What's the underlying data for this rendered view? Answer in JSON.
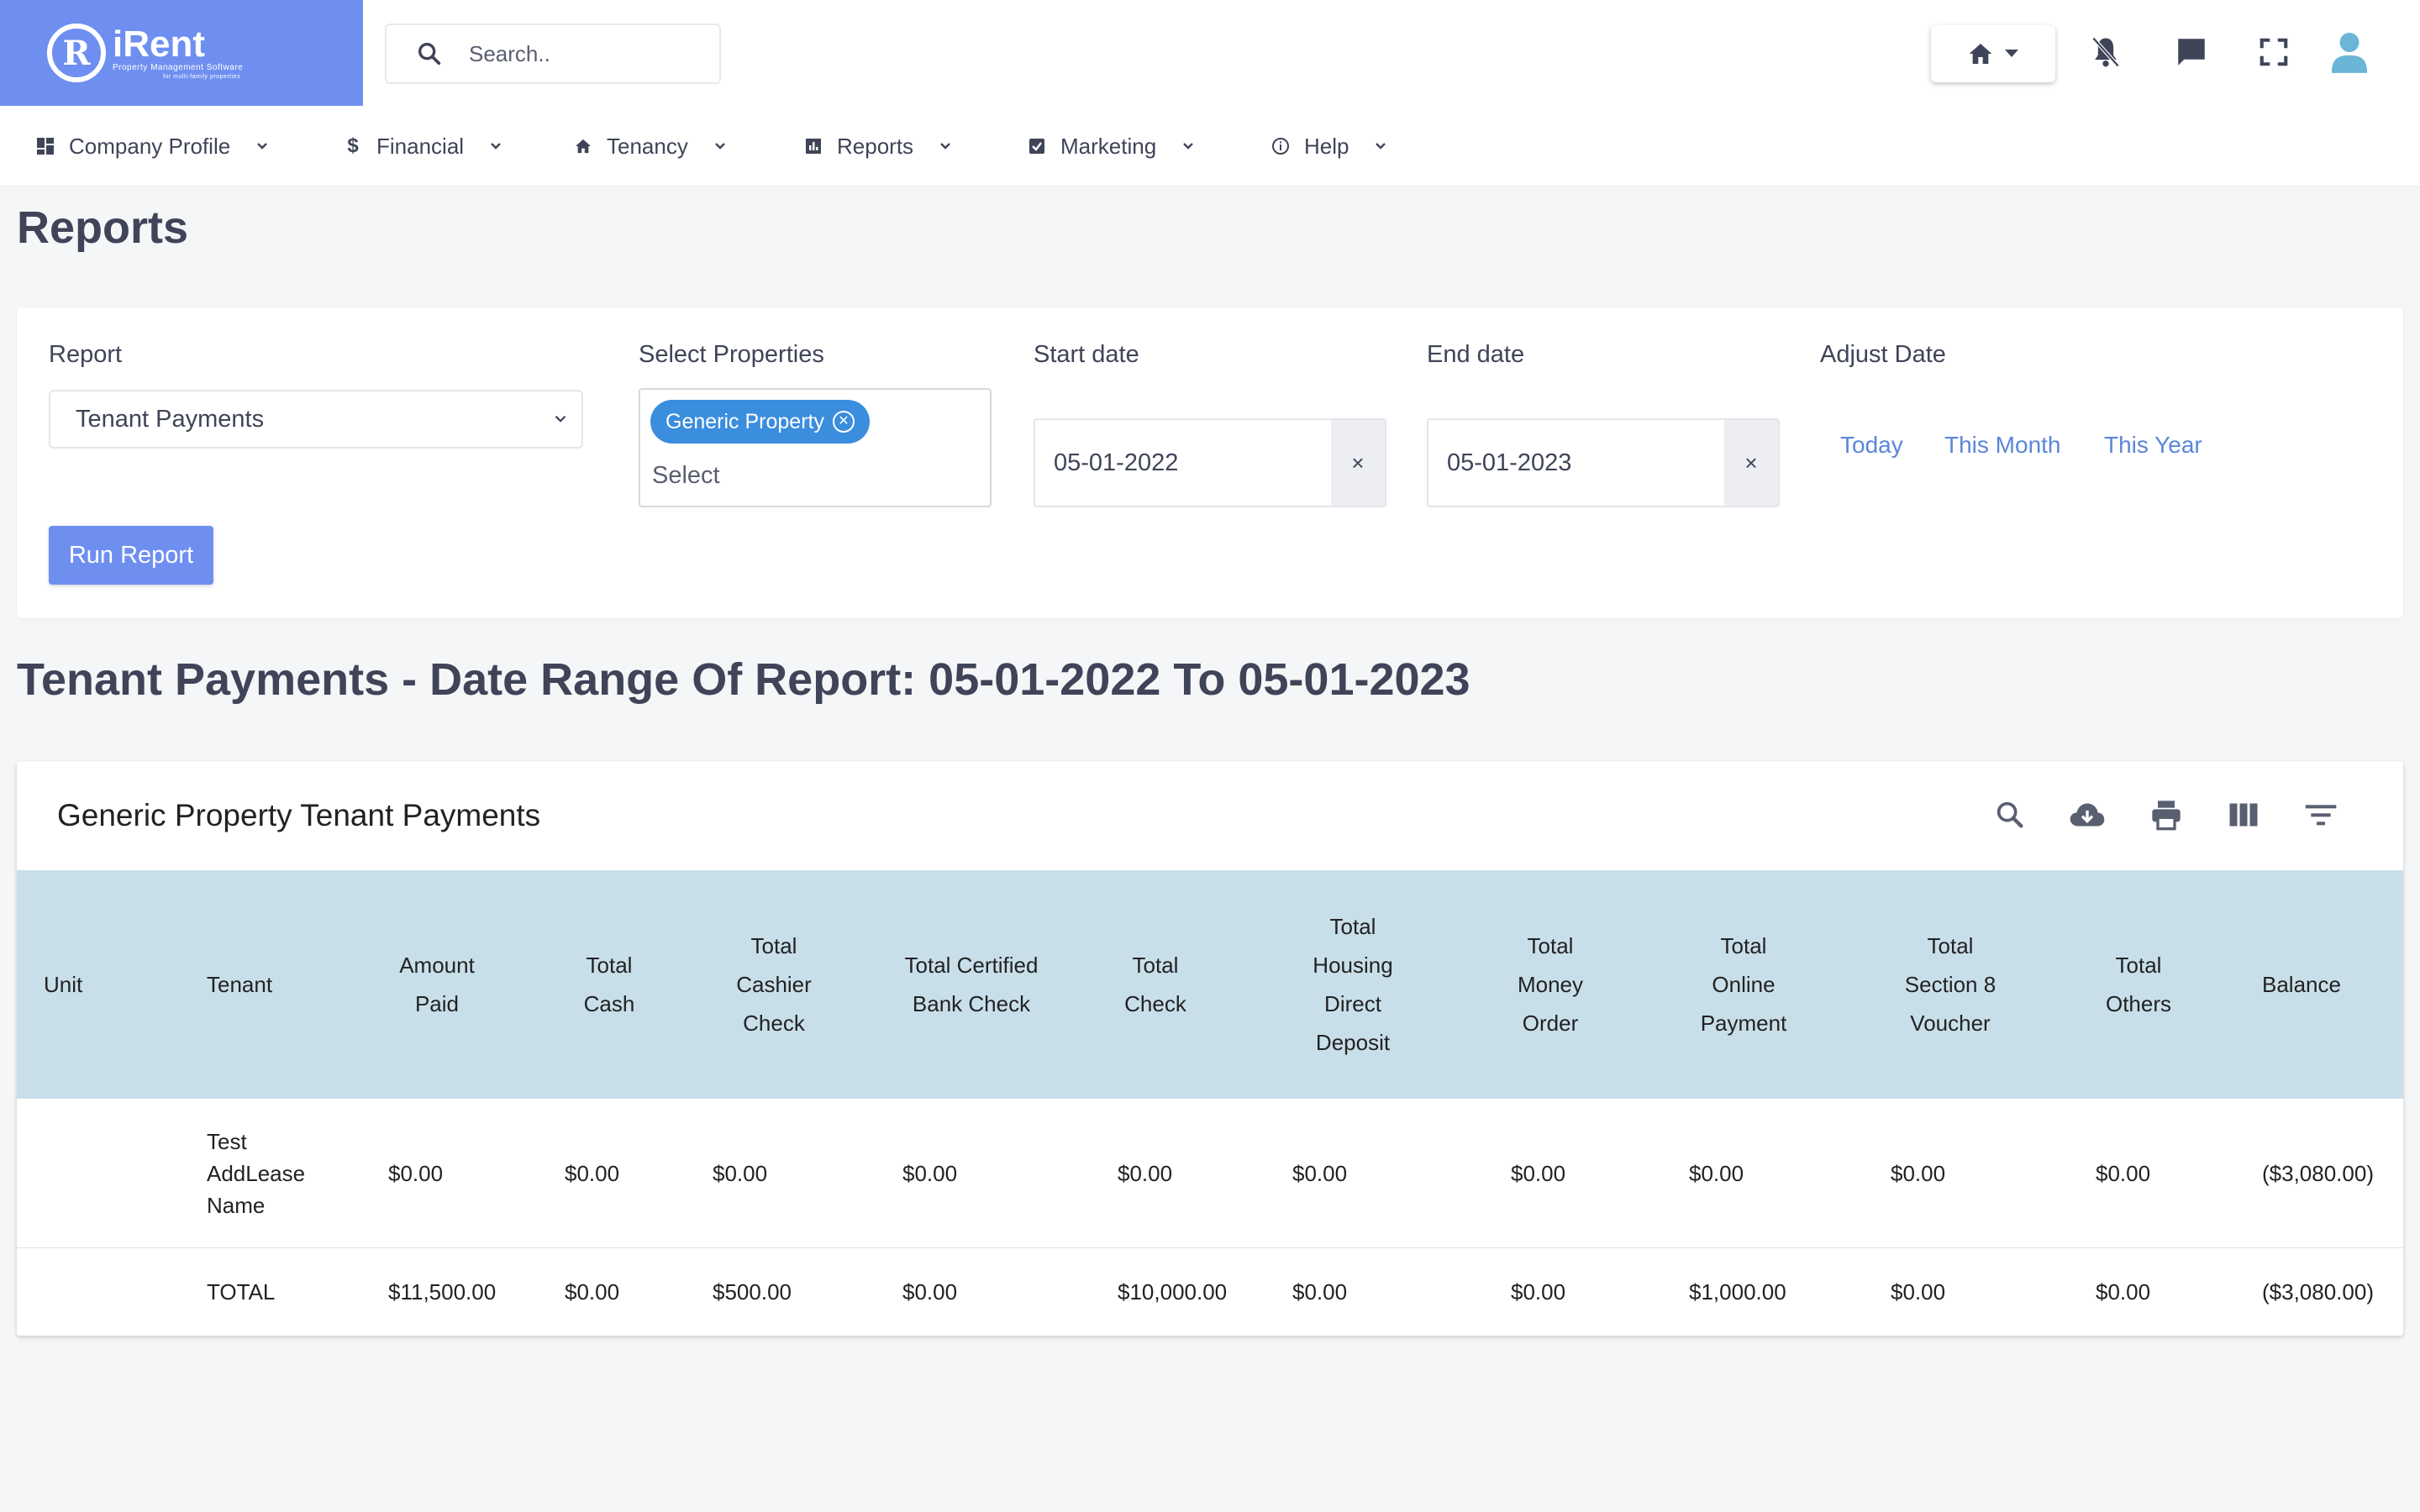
{
  "app": {
    "logo_text": "iRent",
    "logo_subtitle": "Property Management Software",
    "logo_tagline": "for multi-family properties",
    "accent_color": "#6f8ff0",
    "link_color": "#5b86d9",
    "chip_color": "#3b8dde",
    "header_bg": "#c8dfea"
  },
  "search": {
    "placeholder": "Search..",
    "icon": "search-icon"
  },
  "topbar_icons": [
    "home-icon",
    "bell-off-icon",
    "chat-icon",
    "fullscreen-icon",
    "user-icon"
  ],
  "nav": {
    "items": [
      {
        "label": "Company Profile",
        "icon": "dashboard-icon"
      },
      {
        "label": "Financial",
        "icon": "dollar-icon"
      },
      {
        "label": "Tenancy",
        "icon": "home-icon"
      },
      {
        "label": "Reports",
        "icon": "report-icon"
      },
      {
        "label": "Marketing",
        "icon": "checkbox-icon"
      },
      {
        "label": "Help",
        "icon": "info-icon"
      }
    ]
  },
  "page": {
    "title": "Reports"
  },
  "filters": {
    "report_label": "Report",
    "report_value": "Tenant Payments",
    "properties_label": "Select Properties",
    "properties_selected": [
      "Generic Property"
    ],
    "properties_placeholder": "Select",
    "start_label": "Start date",
    "start_value": "05-01-2022",
    "end_label": "End date",
    "end_value": "05-01-2023",
    "clear_symbol": "×",
    "adjust_label": "Adjust Date",
    "adjust_links": [
      "Today",
      "This Month",
      "This Year"
    ],
    "run_button": "Run Report"
  },
  "report": {
    "title": "Tenant Payments - Date Range Of Report: 05-01-2022 To 05-01-2023",
    "card_title": "Generic Property Tenant Payments",
    "tools": [
      "search-icon",
      "cloud-download-icon",
      "print-icon",
      "columns-icon",
      "filter-icon"
    ],
    "columns": [
      "Unit",
      "Tenant",
      "Amount Paid",
      "Total Cash",
      "Total Cashier Check",
      "Total Certified Bank Check",
      "Total Check",
      "Total Housing Direct Deposit",
      "Total Money Order",
      "Total Online Payment",
      "Total Section 8 Voucher",
      "Total Others",
      "Balance"
    ],
    "rows": [
      {
        "unit": "",
        "tenant": "Test AddLease Name",
        "amount_paid": "$0.00",
        "cash": "$0.00",
        "cashier_check": "$0.00",
        "certified_bank_check": "$0.00",
        "check": "$0.00",
        "housing_direct_deposit": "$0.00",
        "money_order": "$0.00",
        "online_payment": "$0.00",
        "section8_voucher": "$0.00",
        "others": "$0.00",
        "balance": "($3,080.00)"
      }
    ],
    "total": {
      "unit": "",
      "tenant": "TOTAL",
      "amount_paid": "$11,500.00",
      "cash": "$0.00",
      "cashier_check": "$500.00",
      "certified_bank_check": "$0.00",
      "check": "$10,000.00",
      "housing_direct_deposit": "$0.00",
      "money_order": "$0.00",
      "online_payment": "$1,000.00",
      "section8_voucher": "$0.00",
      "others": "$0.00",
      "balance": "($3,080.00)"
    }
  }
}
